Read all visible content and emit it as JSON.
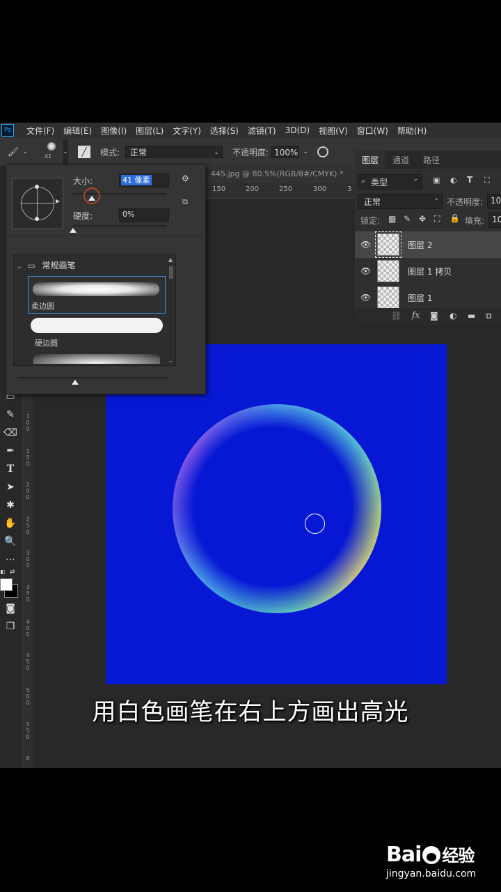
{
  "menubar": {
    "logo": "Ps",
    "items": [
      "文件(F)",
      "编辑(E)",
      "图像(I)",
      "图层(L)",
      "文字(Y)",
      "选择(S)",
      "滤镜(T)",
      "3D(D)",
      "视图(V)",
      "窗口(W)",
      "帮助(H)"
    ]
  },
  "options": {
    "brush_size_number": "41",
    "mode_label": "模式:",
    "mode_value": "正常",
    "opacity_label": "不透明度:",
    "opacity_value": "100%"
  },
  "brush_panel": {
    "size_label": "大小:",
    "size_value": "41 像素",
    "size_slider_fraction": 0.2,
    "hardness_label": "硬度:",
    "hardness_value": "0%",
    "hardness_slider_fraction": 0.0,
    "group_name": "常规画笔",
    "presets": [
      "柔边圆",
      "硬边圆"
    ],
    "selected_preset": "柔边圆"
  },
  "document": {
    "tab_title": "445.jpg @ 80.5%(RGB/8#/CMYK) *",
    "ruler_h_ticks": [
      "150",
      "200",
      "250",
      "300",
      "3"
    ],
    "ruler_v_ticks": [
      "100",
      "150",
      "200",
      "250",
      "300",
      "350",
      "400",
      "450",
      "500",
      "550",
      "6"
    ],
    "canvas_color": "#0718d4"
  },
  "layers_panel": {
    "tabs": [
      "图层",
      "通道",
      "路径"
    ],
    "active_tab": "图层",
    "filter_label": "类型",
    "blend_mode": "正常",
    "opacity_label": "不透明度:",
    "opacity_value": "10",
    "lock_label": "锁定:",
    "fill_label": "填充:",
    "fill_value": "10",
    "layers": [
      {
        "name": "图层 2",
        "selected": true
      },
      {
        "name": "图层 1 拷贝",
        "selected": false
      },
      {
        "name": "图层 1",
        "selected": false
      }
    ]
  },
  "caption": "用白色画笔在右上方画出高光",
  "watermark": {
    "brand": "Bai",
    "brand_suffix": "经验",
    "url": "jingyan.baidu.com"
  },
  "colors": {
    "accent": "#2fa3f0",
    "panel_bg": "#353535",
    "selection_highlight": "#2f6ed8"
  }
}
